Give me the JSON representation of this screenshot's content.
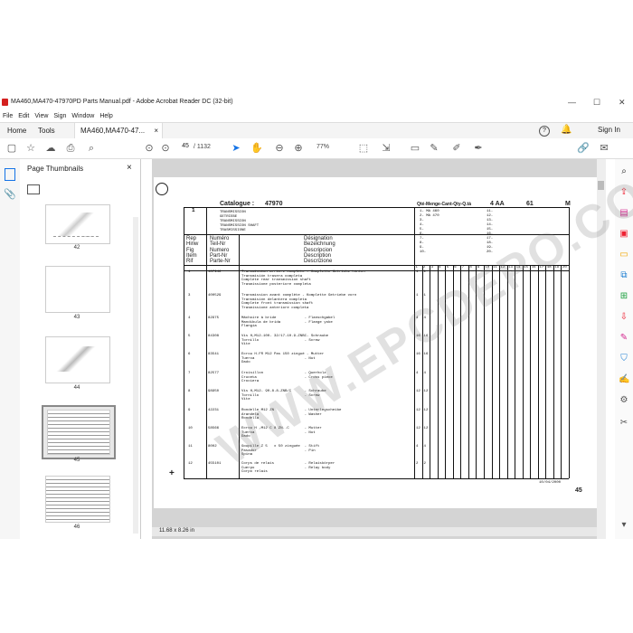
{
  "window": {
    "title": "MA460,MA470-47970PD Parts Manual.pdf - Adobe Acrobat Reader DC (32-bit)",
    "minimize": "—",
    "maximize": "☐",
    "close": "✕"
  },
  "menu": [
    "File",
    "Edit",
    "View",
    "Sign",
    "Window",
    "Help"
  ],
  "tabs": {
    "home": "Home",
    "tools": "Tools",
    "document": "MA460,MA470-47...",
    "doc_close": "×",
    "sign_in": "Sign In"
  },
  "toolbar": {
    "current_page": "45",
    "total_pages": "/ 1132",
    "zoom": "77%"
  },
  "panel": {
    "title": "Page Thumbnails",
    "close": "×",
    "thumbnails": [
      "42",
      "43",
      "44",
      "45",
      "46"
    ]
  },
  "status": {
    "page_size": "11.68 x 8.26 in"
  },
  "document": {
    "section": "1",
    "catalogue_label": "Catalogue :",
    "catalogue_no": "47970",
    "titles": [
      "TRANSMISSION",
      "GETRIEBE",
      "TRANSMISSION",
      "TRANSMISSION SHAFT",
      "TRASMISSIONE"
    ],
    "qty_header": "Qté-Menge-Cant-Qty-Q.tà",
    "model_code": "4 AA",
    "page_code": "61",
    "m_label": "M",
    "models": [
      "1- MA 460",
      "2- MA 470",
      "3-",
      "4-",
      "5-",
      "6-",
      "7-",
      "8-",
      "9-",
      "10-"
    ],
    "models_right": [
      "11-",
      "12-",
      "13-",
      "14-",
      "15-",
      "16-",
      "17-",
      "18-",
      "19-",
      "20-"
    ],
    "rep_header": [
      "Rep",
      "Hinw",
      "Fig",
      "Item",
      "Rif"
    ],
    "numero_header": [
      "Numéro",
      "Teil-Nr",
      "Numero",
      "Part-Nr",
      "Parte-Nr"
    ],
    "designation_header": [
      "Désignation",
      "Bezeichnung",
      "Descripcion",
      "Description",
      "Descrizione"
    ],
    "qty_cols": [
      "1",
      "2",
      "3",
      "4",
      "5",
      "6",
      "7",
      "8",
      "9",
      "10",
      "11",
      "12",
      "13",
      "14",
      "15",
      "16",
      "17",
      "18",
      "19",
      "20"
    ],
    "rows": [
      {
        "rep": "1",
        "num": "187946",
        "desc": [
          "Transmission arrière complète - Komplette Getriebe hinten",
          "Transmisión trasera completa",
          "Complete rear transmission shaft",
          "Trasmissione posteriore completa"
        ],
        "q": [
          "1",
          "1"
        ]
      },
      {
        "rep": "3",
        "num": "400529",
        "desc": [
          "Transmission avant complète - Komplette Getriebe vorn",
          "Transmisión delantera completa",
          "Complete front transmission shaft",
          "Trasmissione anteriore completa"
        ],
        "q": [
          "1",
          "1"
        ]
      },
      {
        "rep": "4",
        "num": "82975",
        "desc": [
          "Mâchoire à bride             - Flanschgabel",
          "Mandíbula de brida           - Flange yoke",
          "Flangia"
        ],
        "q": [
          "4",
          "4"
        ]
      },
      {
        "rep": "5",
        "num": "84308",
        "desc": [
          "Vis H,M12-100- 32/17-10.9-ZNBC- Schraube",
          "Tornillo                     - Screw",
          "Vite"
        ],
        "q": [
          "16",
          "16"
        ]
      },
      {
        "rep": "6",
        "num": "83541",
        "desc": [
          "Ecrou H.FR M12 Pas 150 zingué - Mutter",
          "Tuerca                       - Nut",
          "Dado"
        ],
        "q": [
          "16",
          "16"
        ]
      },
      {
        "rep": "7",
        "num": "82577",
        "desc": [
          "Croisillon                   - Querholz",
          "Cruceta                      - Cross piece",
          "Crociera"
        ],
        "q": [
          "4",
          "4"
        ]
      },
      {
        "rep": "8",
        "num": "98950",
        "desc": [
          "Vis H,M12- 90-8.8-ZNB/C      - Schraube",
          "Tornillo                     - Screw",
          "Vite"
        ],
        "q": [
          "12",
          "12"
        ]
      },
      {
        "rep": "9",
        "num": "42231",
        "desc": [
          "Rondelle M12 ZN              - Unterlegscheibe",
          "Arandela                     - Washer",
          "Rondella"
        ],
        "q": [
          "12",
          "12"
        ]
      },
      {
        "rep": "10",
        "num": "58566",
        "desc": [
          "Ecrou H ,M12 C 8 ZN..C       - Mutter",
          "Tuerca                       - Nut",
          "Dado"
        ],
        "q": [
          "12",
          "12"
        ]
      },
      {
        "rep": "11",
        "num": "8002",
        "desc": [
          "Goupille Z 5   x 50 zinguée  - Stift",
          "Pasador                      - Pin",
          "Spina"
        ],
        "q": [
          "4",
          "4"
        ]
      },
      {
        "rep": "12",
        "num": "455101",
        "desc": [
          "Corps de relais              - Relaiskörper",
          "Cuerpo                       - Relay body",
          "Corpo relais"
        ],
        "q": [
          "2",
          "2"
        ]
      }
    ],
    "date": "10/04/2000",
    "page_number": "45",
    "plus": "+"
  },
  "watermark": "WWW.EPCDEPO.COM"
}
